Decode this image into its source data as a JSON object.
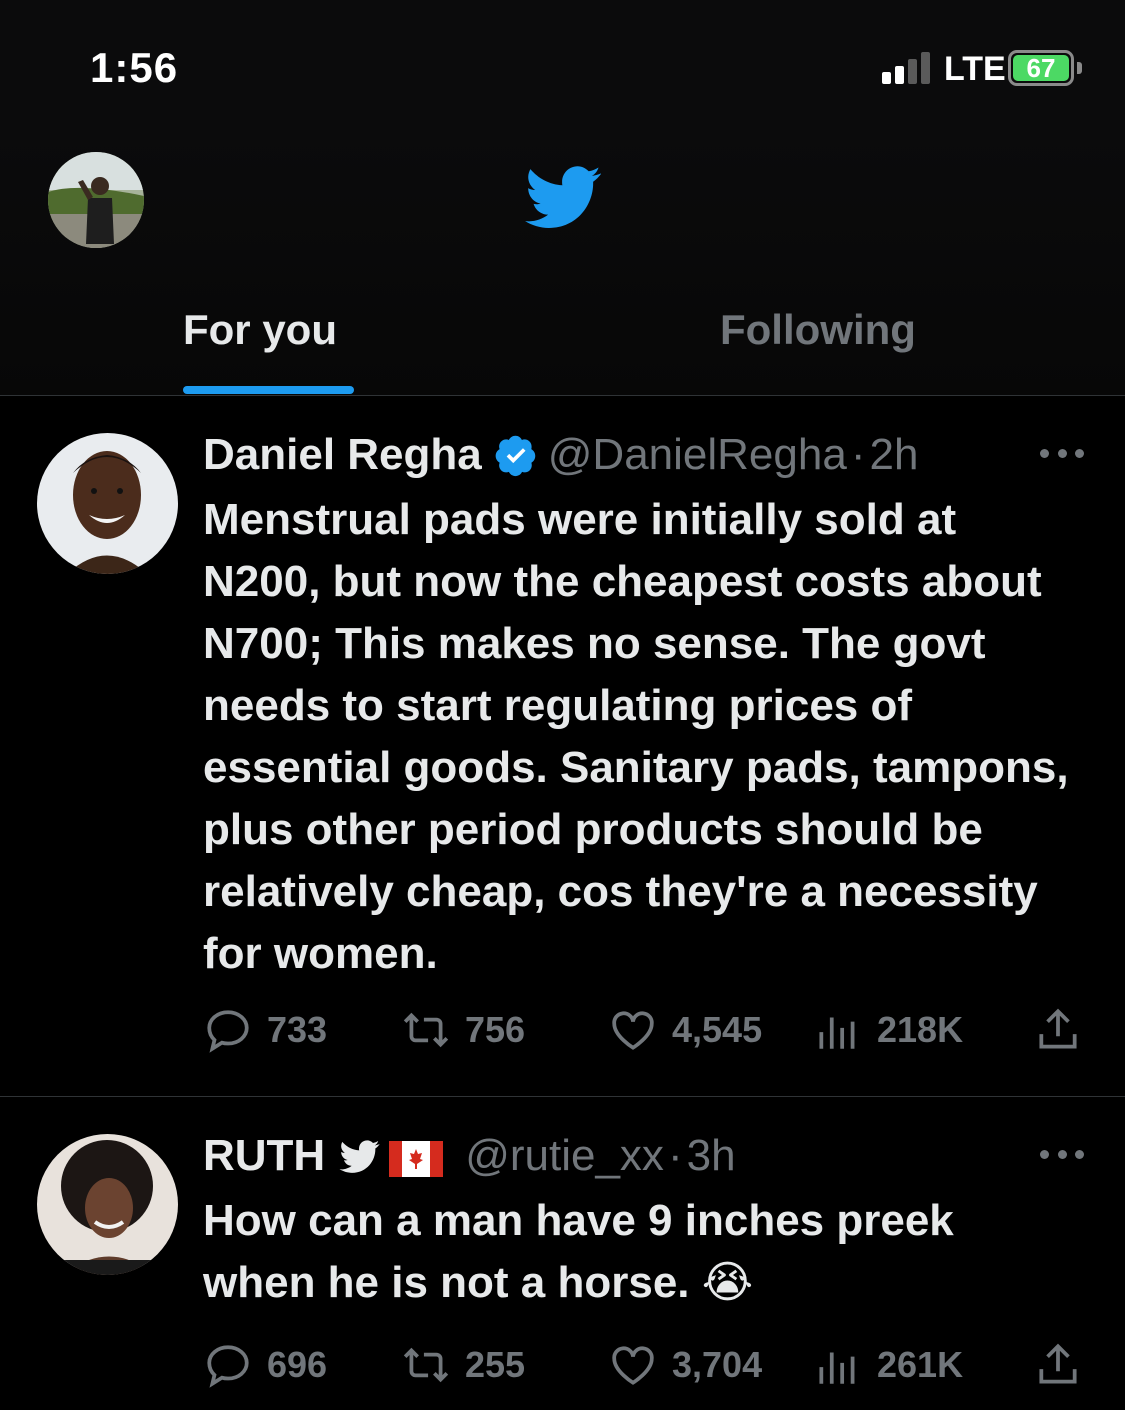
{
  "status_bar": {
    "time": "1:56",
    "network": "LTE",
    "battery": "67",
    "signal_bars_active": 2,
    "signal_bars_total": 4
  },
  "header": {
    "logo_icon": "twitter-bird-icon",
    "avatar_icon": "profile-avatar",
    "tabs": [
      {
        "label": "For you",
        "active": true
      },
      {
        "label": "Following",
        "active": false
      }
    ]
  },
  "colors": {
    "accent": "#1d9bf0",
    "text_primary": "#e7e9ea",
    "text_secondary": "#71767b",
    "divider": "#2f3336",
    "battery": "#4cd964"
  },
  "tweets": [
    {
      "name": "Daniel Regha",
      "verified": true,
      "handle": "@DanielRegha",
      "separator": "·",
      "time": "2h",
      "text": "Menstrual pads were initially sold at N200, but now the cheapest costs about N700; This makes no sense. The govt needs to start regulating prices of essential goods. Sanitary pads, tampons, plus other period products should be relatively cheap, cos they're a necessity for women.",
      "replies": "733",
      "retweets": "756",
      "likes": "4,545",
      "views": "218K"
    },
    {
      "name": "RUTH",
      "verified": false,
      "name_badges": [
        "twitter-bird-icon",
        "canada-flag-icon"
      ],
      "handle": "@rutie_xx",
      "separator": "·",
      "time": "3h",
      "text": "How can a man have 9 inches preek when he is not a horse.",
      "emoji": "😭",
      "replies": "696",
      "retweets": "255",
      "likes": "3,704",
      "views": "261K"
    }
  ]
}
